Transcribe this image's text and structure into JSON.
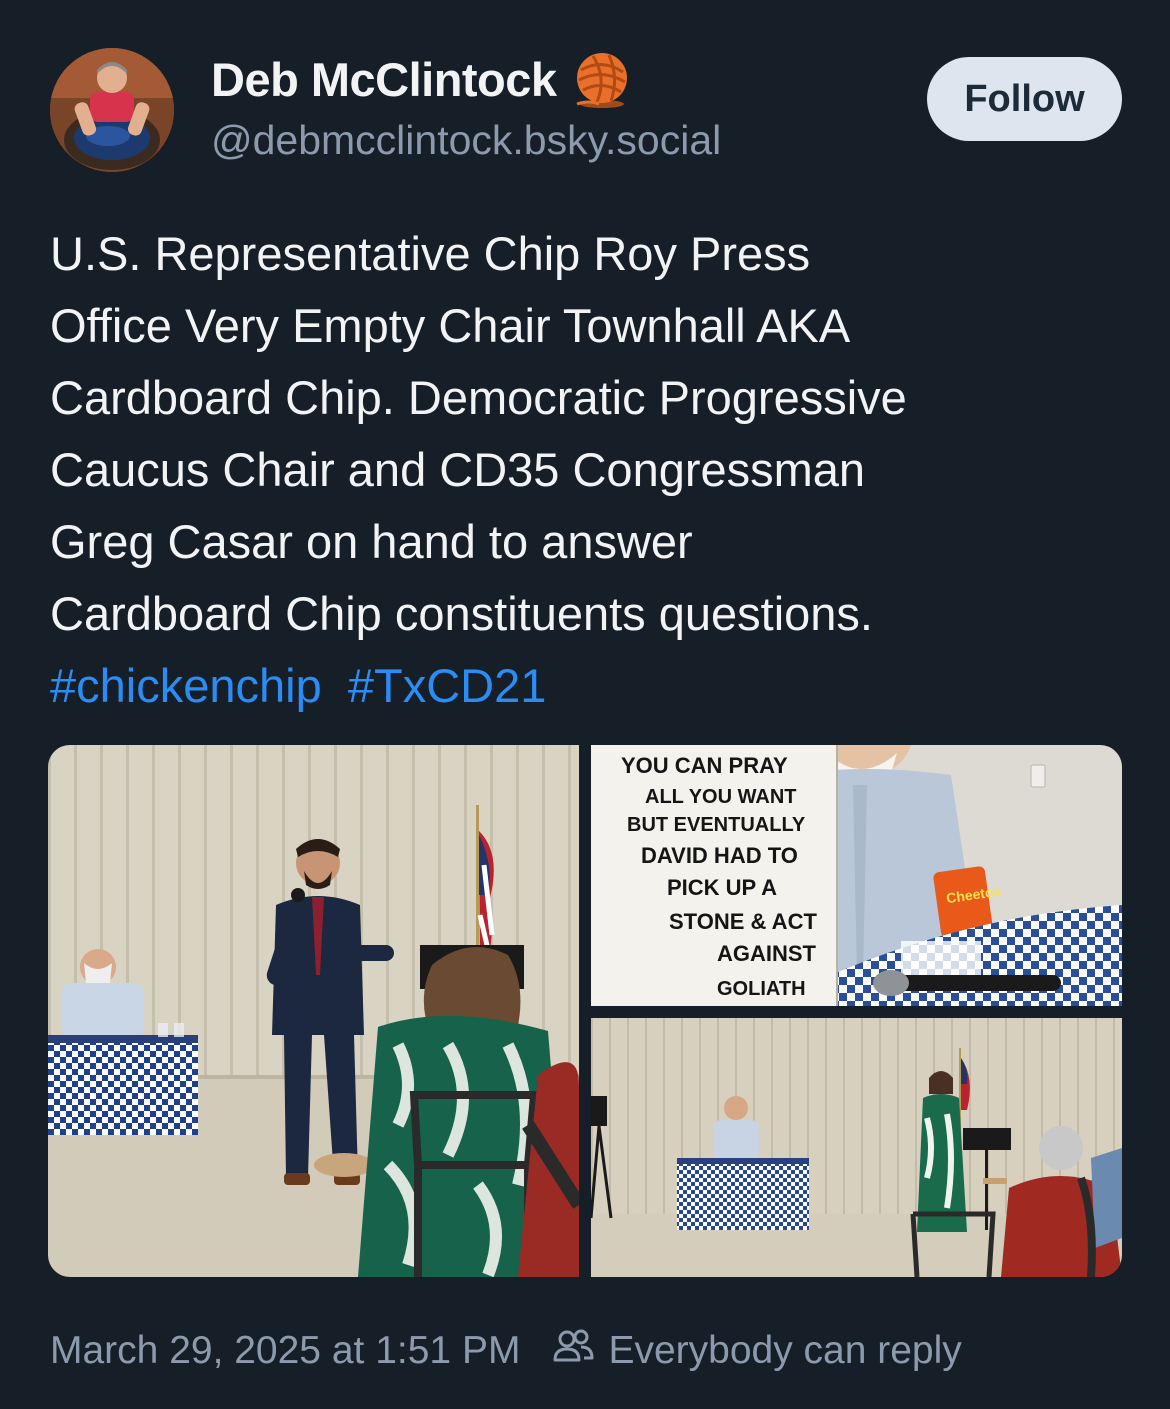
{
  "author": {
    "display_name": "Deb McClintock",
    "name_emoji_icon": "yarn-ball-icon",
    "handle": "@debmcclintock.bsky.social"
  },
  "follow_label": "Follow",
  "post": {
    "lines": [
      "U.S. Representative Chip Roy Press",
      "Office Very Empty Chair Townhall AKA",
      "Cardboard Chip. Democratic Progressive",
      "Caucus Chair and CD35 Congressman",
      "Greg Casar on hand to answer",
      "Cardboard Chip constituents questions."
    ],
    "hashtags": [
      "#chickenchip",
      "#TxCD21"
    ]
  },
  "images": {
    "sign_text": [
      "YOU CAN PRAY",
      "ALL YOU WANT",
      "BUT EVENTUALLY",
      "DAVID HAD TO",
      "PICK UP A",
      "STONE & ACT",
      "AGAINST",
      "GOLIATH"
    ]
  },
  "footer": {
    "timestamp": "March 29, 2025 at 1:51 PM",
    "reply_setting": "Everybody can reply",
    "reply_icon": "people-icon"
  },
  "colors": {
    "background": "#161e27",
    "hashtag": "#2a8cf5",
    "muted": "#8c9aad",
    "follow_bg": "#dfe5ee"
  }
}
